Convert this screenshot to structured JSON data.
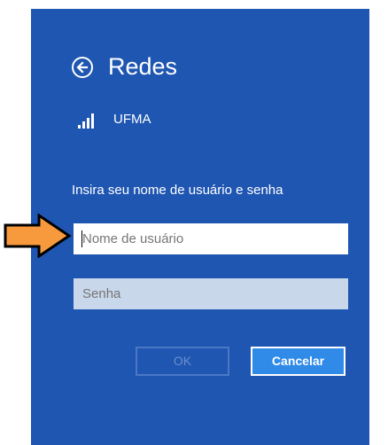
{
  "title": "Redes",
  "network": {
    "name": "UFMA"
  },
  "login": {
    "prompt": "Insira seu nome de usuário e senha",
    "username_placeholder": "Nome de usuário",
    "password_placeholder": "Senha"
  },
  "buttons": {
    "ok": "OK",
    "cancel": "Cancelar"
  },
  "colors": {
    "panel": "#1f56b2",
    "cancel": "#2f8ae8",
    "password_field": "#c9d7ea",
    "arrow": "#f79a3d"
  },
  "icons": [
    "back-arrow-icon",
    "signal-strength-icon",
    "pointer-arrow-icon"
  ]
}
